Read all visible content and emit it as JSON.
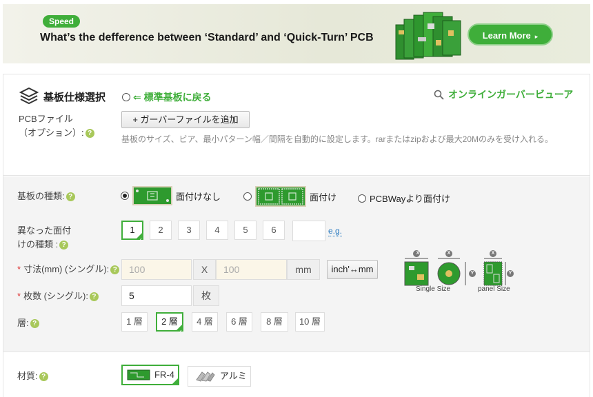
{
  "banner": {
    "badge": "Speed",
    "title": "What’s the defference between ‘Standard’ and ‘Quick-Turn’ PCB",
    "cta": "Learn More",
    "cta_arrow": "▸"
  },
  "section": {
    "title": "基板仕様選択",
    "back_link": "⇐ 標準基板に戻る",
    "viewer_link": "オンラインガーバービューア"
  },
  "pcb_file": {
    "label_line1": "PCBファイル",
    "label_line2": "（オプション）:",
    "button": "+ ガーバーファイルを追加",
    "hint": "基板のサイズ、ビア、最小パターン幅／間隔を自動的に設定します。rarまたはzipおよび最大20Mのみを受け入れる。"
  },
  "board_type": {
    "label": "基板の種類:",
    "options": [
      "面付けなし",
      "面付け",
      "PCBWayより面付け"
    ],
    "selected": "面付けなし"
  },
  "designs": {
    "label_line1": "異なった面付",
    "label_line2": "けの種類 :",
    "options": [
      "1",
      "2",
      "3",
      "4",
      "5",
      "6"
    ],
    "selected": "1",
    "custom_value": "",
    "eg": "e.g."
  },
  "size": {
    "label": "寸法(mm) (シングル):",
    "x_placeholder": "100",
    "sep": "X",
    "y_placeholder": "100",
    "unit": "mm",
    "convert": "inch'↔mm",
    "single_caption": "Single Size",
    "panel_caption": "panel Size",
    "dim_x": "X",
    "dim_y": "Y"
  },
  "quantity": {
    "label": "枚数 (シングル):",
    "value": "5",
    "unit": "枚"
  },
  "layers": {
    "label": "層:",
    "options": [
      "1 層",
      "2 層",
      "4 層",
      "6 層",
      "8 層",
      "10 層"
    ],
    "selected": "2 層"
  },
  "material": {
    "label": "材質:",
    "options": [
      "FR-4",
      "アルミ"
    ],
    "selected": "FR-4"
  },
  "colors": {
    "accent": "#3fae3a",
    "help": "#a8c85a",
    "required": "#dd3333",
    "link": "#2a7ac0"
  }
}
